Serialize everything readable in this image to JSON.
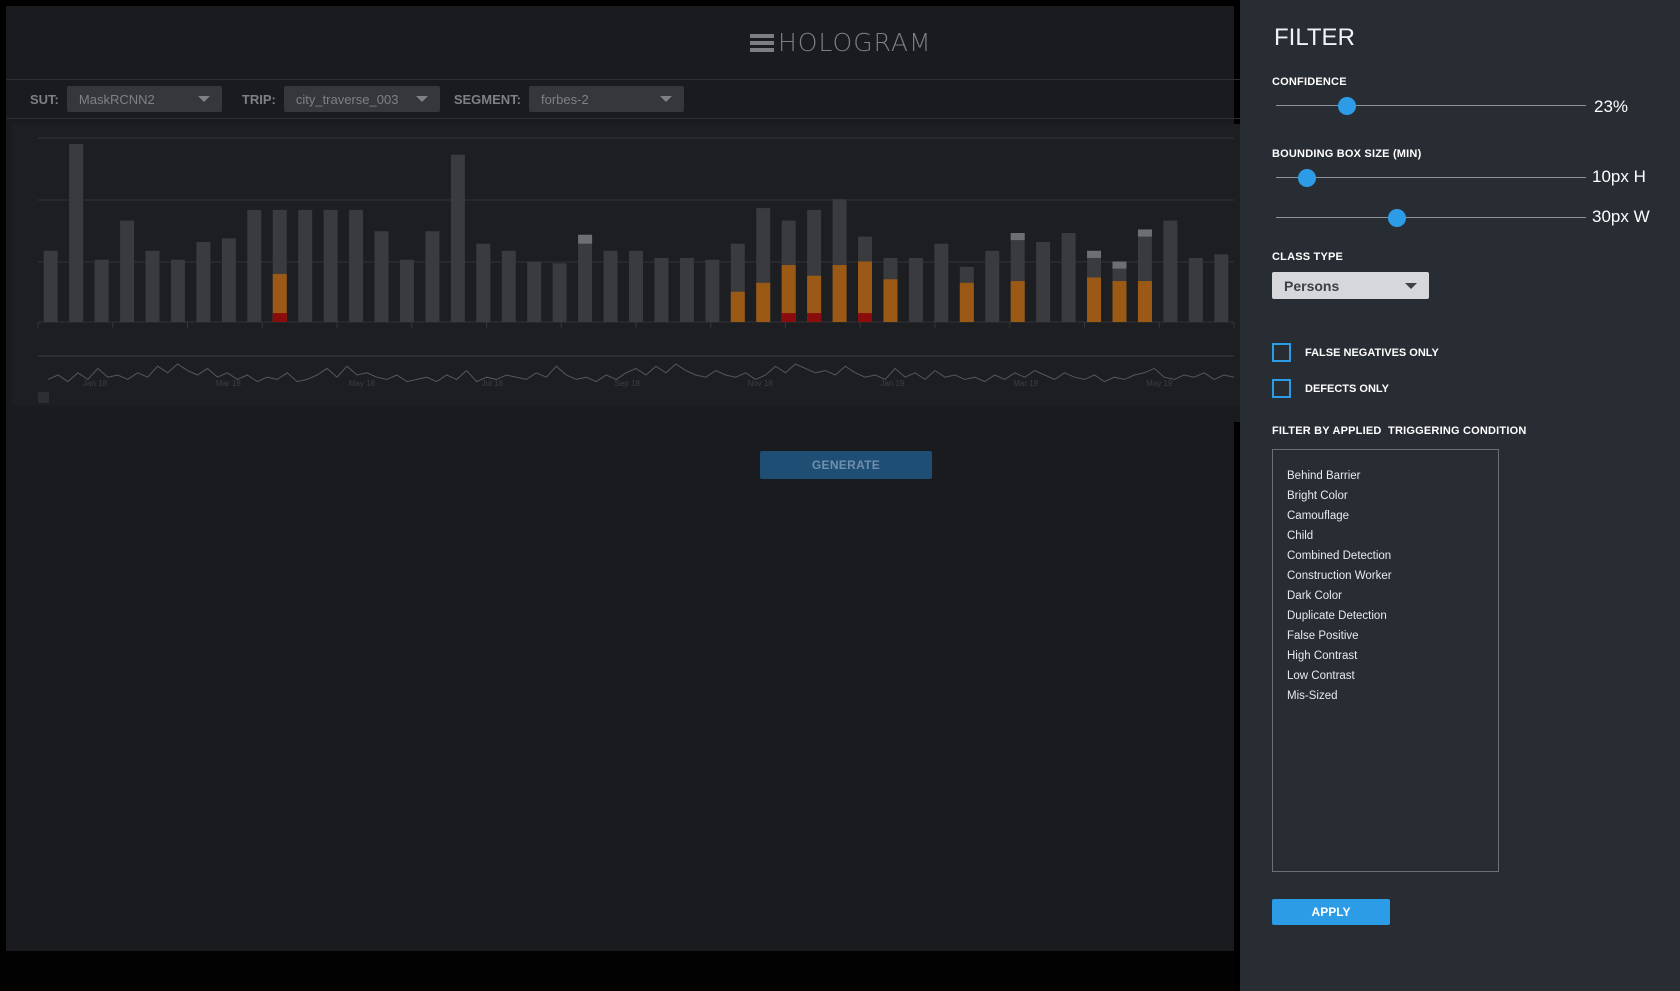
{
  "app": {
    "logo_text": "HOLOGRAM"
  },
  "selectors": {
    "sut_label": "SUT:",
    "sut_value": "MaskRCNN2",
    "trip_label": "TRIP:",
    "trip_value": "city_traverse_003",
    "segment_label": "SEGMENT:",
    "segment_value": "forbes-2"
  },
  "generate_label": "GENERATE",
  "filter": {
    "title": "FILTER",
    "confidence": {
      "label": "CONFIDENCE",
      "value": 0.23,
      "value_text": "23%"
    },
    "bbox": {
      "label": "BOUNDING BOX SIZE (MIN)",
      "height": {
        "value_text": "10px H",
        "fraction": 0.1
      },
      "width": {
        "value_text": "30px W",
        "fraction": 0.39
      }
    },
    "class_type": {
      "label": "CLASS TYPE",
      "value": "Persons"
    },
    "false_negatives_label": "FALSE NEGATIVES ONLY",
    "defects_label": "DEFECTS ONLY",
    "conditions_label": "FILTER BY APPLIED  TRIGGERING CONDITION",
    "conditions": [
      "Behind Barrier",
      "Bright Color",
      "Camouflage",
      "Child",
      "Combined Detection",
      "Construction Worker",
      "Dark Color",
      "Duplicate Detection",
      "False Positive",
      "High Contrast",
      "Low Contrast",
      "Mis-Sized"
    ],
    "apply_label": "APPLY"
  },
  "colors": {
    "accent": "#2d9ce6",
    "bar": "#3a3b3e",
    "orange": "#9a5a15",
    "red": "#8a0c0c",
    "light": "#6e6f72"
  },
  "chart_data": {
    "type": "bar",
    "stacked": true,
    "x_ticks": [
      "Jan 18",
      "Mar 18",
      "May 18",
      "Jul 18",
      "Sep 18",
      "Nov 18",
      "Jan 19",
      "Mar 19",
      "May 19"
    ],
    "series": [
      {
        "values": [
          0.4,
          1,
          0.35,
          0.57,
          0.4,
          0.35,
          0.45,
          0.47,
          0.63,
          0.63,
          0.63,
          0.63,
          0.63,
          0.51,
          0.35,
          0.51,
          0.94,
          0.44,
          0.4,
          0.34,
          0.33,
          0.49,
          0.4,
          0.4,
          0.36,
          0.36,
          0.35,
          0.44,
          0.64,
          0.57,
          0.63,
          0.69,
          0.48,
          0.36,
          0.36,
          0.44,
          0.31,
          0.4,
          0.5,
          0.45,
          0.5,
          0.4,
          0.34,
          0.52,
          0.57,
          0.36,
          0.38
        ]
      },
      {
        "values": [
          0,
          0,
          0,
          0,
          0,
          0,
          0,
          0,
          0,
          0.27,
          0,
          0,
          0,
          0,
          0,
          0,
          0,
          0,
          0,
          0,
          0,
          0,
          0,
          0,
          0,
          0,
          0,
          0.17,
          0.22,
          0.32,
          0.26,
          0.32,
          0.34,
          0.24,
          0,
          0,
          0.22,
          0,
          0.23,
          0,
          0,
          0.25,
          0.23,
          0.23,
          0,
          0,
          0
        ]
      },
      {
        "values": [
          0,
          0,
          0,
          0,
          0,
          0,
          0,
          0,
          0,
          0.05,
          0,
          0,
          0,
          0,
          0,
          0,
          0,
          0,
          0,
          0,
          0,
          0,
          0,
          0,
          0,
          0,
          0,
          0,
          0,
          0.05,
          0.05,
          0,
          0.05,
          0,
          0,
          0,
          0,
          0,
          0,
          0,
          0,
          0,
          0,
          0,
          0,
          0,
          0
        ]
      },
      {
        "values": [
          0,
          0,
          0,
          0,
          0,
          0,
          0,
          0,
          0,
          0,
          0,
          0,
          0,
          0,
          0,
          0,
          0,
          0,
          0,
          0,
          0,
          0.05,
          0,
          0,
          0,
          0,
          0,
          0,
          0,
          0,
          0,
          0,
          0,
          0,
          0,
          0,
          0,
          0,
          0.04,
          0,
          0,
          0.04,
          0.04,
          0.04,
          0,
          0,
          0
        ]
      }
    ],
    "timeline": [
      0.3,
      0.5,
      0.2,
      0.6,
      0.3,
      0.8,
      0.4,
      0.5,
      0.3,
      0.6,
      0.4,
      0.9,
      0.6,
      1.0,
      0.7,
      0.5,
      0.8,
      0.4,
      0.6,
      0.3,
      0.5,
      0.2,
      0.4,
      0.3,
      0.6,
      0.2,
      0.3,
      0.5,
      0.8,
      0.4,
      0.9,
      0.5,
      0.6,
      0.4,
      0.3,
      0.5,
      0.2,
      0.3,
      0.4,
      0.2,
      0.5,
      0.3,
      0.7,
      0.2,
      0.4,
      0.3,
      0.5,
      0.4,
      0.3,
      0.6,
      0.4,
      0.9,
      0.5,
      0.3,
      0.4,
      0.2,
      0.5,
      0.3,
      0.6,
      0.8,
      0.5,
      0.9,
      0.6,
      1.0,
      0.7,
      0.5,
      0.4,
      0.7,
      0.5,
      0.4,
      0.6,
      0.3,
      0.5,
      0.9,
      0.6,
      1.0,
      0.8,
      0.6,
      0.7,
      0.5,
      0.9,
      0.6,
      0.4,
      0.5,
      0.3,
      0.8,
      0.4,
      0.6,
      0.3,
      0.7,
      0.4,
      0.5,
      0.3,
      0.4,
      0.2,
      0.5,
      0.3,
      0.6,
      0.4,
      0.7,
      0.5,
      0.3,
      0.6,
      0.4,
      0.3,
      0.5,
      0.2,
      0.4,
      0.3,
      0.5,
      0.6,
      0.8,
      0.4,
      0.3,
      0.5,
      0.4,
      0.6,
      0.3,
      0.5,
      0.4
    ]
  }
}
